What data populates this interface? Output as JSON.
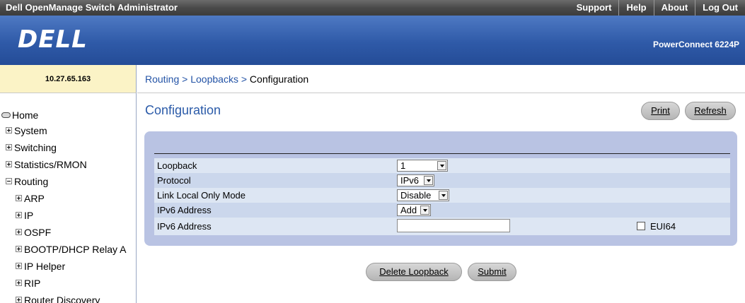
{
  "header": {
    "app_title": "Dell OpenManage Switch Administrator",
    "links": [
      "Support",
      "Help",
      "About",
      "Log Out"
    ]
  },
  "brand": {
    "logo_text": "DELL",
    "model": "PowerConnect 6224P"
  },
  "device": {
    "ip": "10.27.65.163"
  },
  "breadcrumb": {
    "items": [
      "Routing",
      "Loopbacks",
      "Configuration"
    ],
    "separator": ">"
  },
  "page": {
    "title": "Configuration"
  },
  "actions": {
    "print": "Print",
    "refresh": "Refresh"
  },
  "nav": {
    "items": [
      {
        "label": "Home",
        "icon": "home-disk-icon"
      },
      {
        "label": "System",
        "icon": "plus-icon"
      },
      {
        "label": "Switching",
        "icon": "plus-icon"
      },
      {
        "label": "Statistics/RMON",
        "icon": "plus-icon"
      },
      {
        "label": "Routing",
        "icon": "minus-icon"
      },
      {
        "label": "ARP",
        "icon": "plus-icon"
      },
      {
        "label": "IP",
        "icon": "plus-icon"
      },
      {
        "label": "OSPF",
        "icon": "plus-icon"
      },
      {
        "label": "BOOTP/DHCP Relay A",
        "icon": "plus-icon"
      },
      {
        "label": "IP Helper",
        "icon": "plus-icon"
      },
      {
        "label": "RIP",
        "icon": "plus-icon"
      },
      {
        "label": "Router Discovery",
        "icon": "plus-icon"
      }
    ]
  },
  "form": {
    "loopback": {
      "label": "Loopback",
      "value": "1"
    },
    "protocol": {
      "label": "Protocol",
      "value": "IPv6"
    },
    "link_local": {
      "label": "Link Local Only Mode",
      "value": "Disable"
    },
    "ipv6_action": {
      "label": "IPv6 Address",
      "value": "Add"
    },
    "ipv6_address": {
      "label": "IPv6 Address",
      "value": "",
      "eui64_label": "EUI64",
      "eui64_checked": false
    }
  },
  "buttons": {
    "delete_loopback": "Delete Loopback",
    "submit": "Submit"
  },
  "colors": {
    "topbar": "#4a4a4a",
    "brand_blue": "#2f5aa8",
    "ip_box": "#fbf3c6",
    "panel": "#b9c3e3",
    "row_light": "#dde6f3",
    "row_mid": "#cbd7ec",
    "title_blue": "#2a5aa8"
  }
}
